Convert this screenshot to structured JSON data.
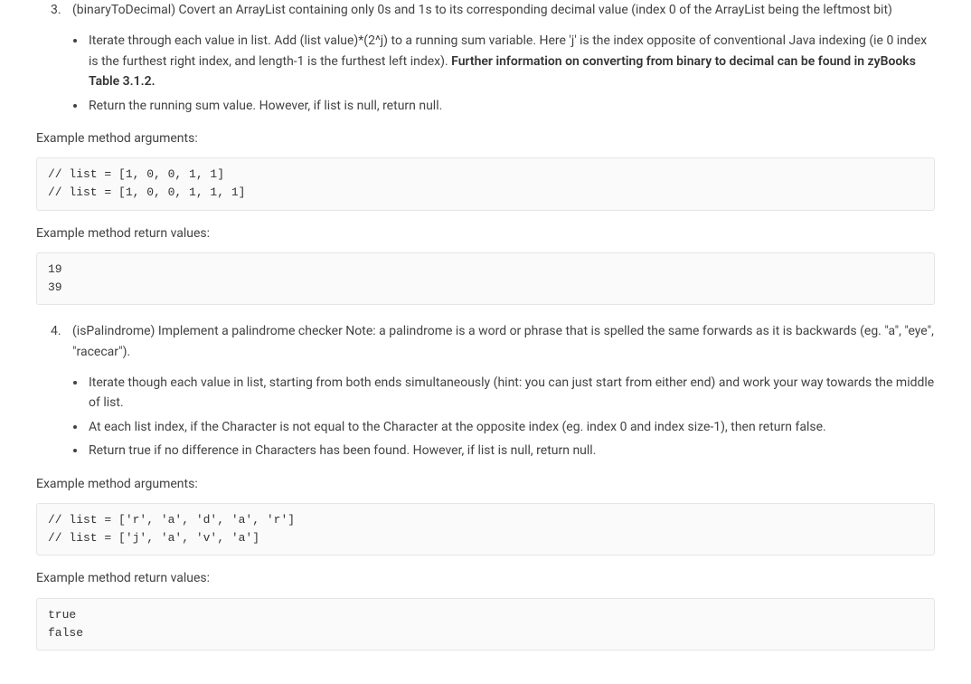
{
  "q3": {
    "num": "3.",
    "name": "(binaryToDecimal)",
    "desc": " Covert an ArrayList containing only 0s and 1s to its corresponding decimal value (index 0 of the ArrayList being the leftmost bit)",
    "bullet1_pre": "Iterate through each value in list. Add (list value)*(2^j) to a running sum variable. Here 'j' is the index opposite of conventional Java indexing (ie 0 index is the furthest right index, and length-1 is the furthest left index). ",
    "bullet1_bold": "Further information on converting from binary to decimal can be found in zyBooks Table 3.1.2.",
    "bullet2": "Return the running sum value. However, if list is null, return null.",
    "args_label": "Example method arguments:",
    "args_code": "// list = [1, 0, 0, 1, 1]\n// list = [1, 0, 0, 1, 1, 1]",
    "returns_label": "Example method return values:",
    "returns_code": "19\n39"
  },
  "q4": {
    "num": "4.",
    "name": "(isPalindrome)",
    "desc": " Implement a palindrome checker Note: a palindrome is a word or phrase that is spelled the same forwards as it is backwards (eg. \"a\", \"eye\", \"racecar\").",
    "bullet1": "Iterate though each value in list, starting from both ends simultaneously (hint: you can just start from either end) and work your way towards the middle of list.",
    "bullet2": "At each list index, if the Character is not equal to the Character at the opposite index (eg. index 0 and index size-1), then return false.",
    "bullet3": "Return true if no difference in Characters has been found. However, if list is null, return null.",
    "args_label": "Example method arguments:",
    "args_code": "// list = ['r', 'a', 'd', 'a', 'r']\n// list = ['j', 'a', 'v', 'a']",
    "returns_label": "Example method return values:",
    "returns_code": "true\nfalse"
  }
}
